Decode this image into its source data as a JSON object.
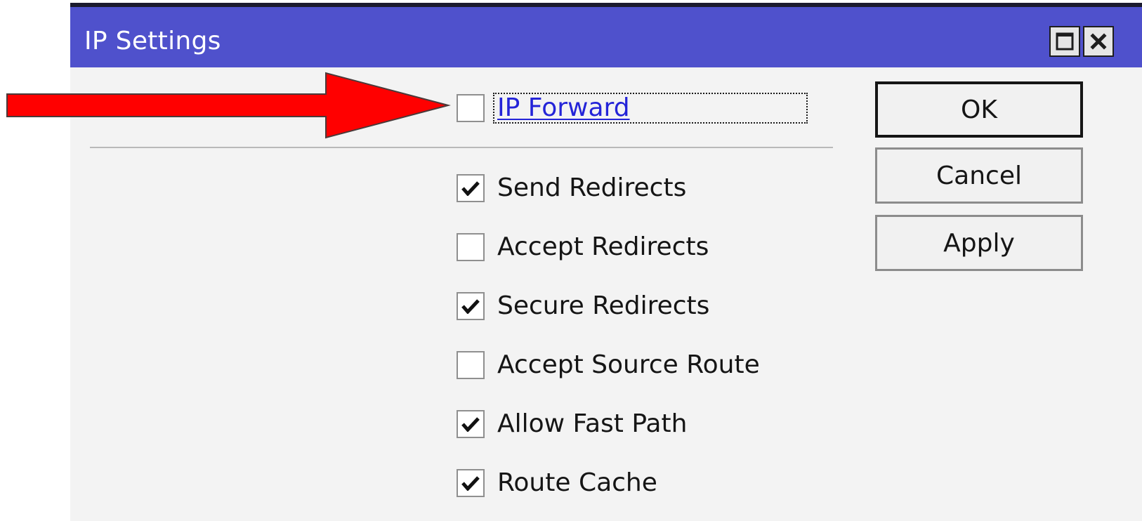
{
  "window": {
    "title": "IP Settings",
    "title_buttons": [
      {
        "name": "maximize",
        "icon": "maximize-icon"
      },
      {
        "name": "close",
        "icon": "close-icon"
      }
    ]
  },
  "settings": {
    "ip_forward": {
      "label": "IP Forward",
      "checked": false,
      "focused": true
    },
    "options": [
      {
        "label": "Send Redirects",
        "checked": true
      },
      {
        "label": "Accept Redirects",
        "checked": false
      },
      {
        "label": "Secure Redirects",
        "checked": true
      },
      {
        "label": "Accept Source Route",
        "checked": false
      },
      {
        "label": "Allow Fast Path",
        "checked": true
      },
      {
        "label": "Route Cache",
        "checked": true
      }
    ]
  },
  "buttons": {
    "ok": "OK",
    "cancel": "Cancel",
    "apply": "Apply"
  },
  "annotation": {
    "arrow_color": "#ff0000",
    "points_to": "IP Forward"
  },
  "colors": {
    "titlebar": "#4f51cc",
    "window_bg": "#f3f3f3",
    "focused_label": "#2424d8"
  }
}
